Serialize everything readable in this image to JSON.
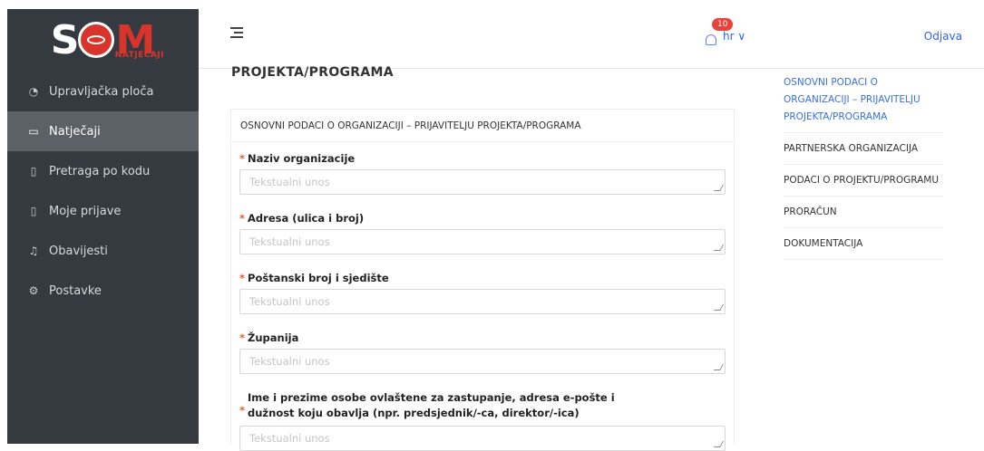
{
  "brand": {
    "logo_text": "SOM",
    "logo_subtitle": "NATJEČAJI"
  },
  "sidebar": {
    "items": [
      {
        "label": "Upravljačka ploča",
        "icon": "dashboard-icon"
      },
      {
        "label": "Natječaji",
        "icon": "folder-icon",
        "active": true
      },
      {
        "label": "Pretraga po kodu",
        "icon": "file-search-icon"
      },
      {
        "label": "Moje prijave",
        "icon": "document-icon"
      },
      {
        "label": "Obavijesti",
        "icon": "bell-icon"
      },
      {
        "label": "Postavke",
        "icon": "gear-icon"
      }
    ]
  },
  "topbar": {
    "notification_count": "10",
    "language": "hr ∨",
    "logout_label": "Odjava"
  },
  "main": {
    "page_heading": "PROJEKTA/PROGRAMA",
    "section_title": "OSNOVNI PODACI O ORGANIZACIJI – PRIJAVITELJU PROJEKTA/PROGRAMA",
    "fields": [
      {
        "label": "Naziv organizacije",
        "placeholder": "Tekstualni unos"
      },
      {
        "label": "Adresa (ulica i broj)",
        "placeholder": "Tekstualni unos"
      },
      {
        "label": "Poštanski broj i sjedište",
        "placeholder": "Tekstualni unos"
      },
      {
        "label": "Županija",
        "placeholder": "Tekstualni unos"
      },
      {
        "label_line1": "Ime i prezime osobe ovlaštene za zastupanje, adresa e-pošte i",
        "label_line2": "dužnost koju obavlja (npr. predsjednik/-ca, direktor/-ica)",
        "placeholder": "Tekstualni unos"
      }
    ]
  },
  "toc": {
    "items": [
      {
        "label": "OSNOVNI PODACI O ORGANIZACIJI – PRIJAVITELJU PROJEKTA/PROGRAMA",
        "active": true
      },
      {
        "label": "PARTNERSKA ORGANIZACIJA"
      },
      {
        "label": "PODACI O PROJEKTU/PROGRAMU"
      },
      {
        "label": "PRORAČUN"
      },
      {
        "label": "DOKUMENTACIJA"
      }
    ]
  },
  "colors": {
    "sidebar_bg": "#343a40",
    "sidebar_active": "#5c6167",
    "accent": "#3a6fe0",
    "brand_red": "#d9342b",
    "required": "#e25a3f"
  }
}
